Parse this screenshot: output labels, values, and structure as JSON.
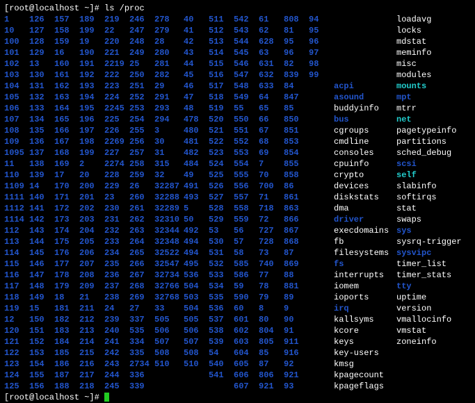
{
  "prompt1": "[root@localhost ~]# ",
  "command": "ls  /proc",
  "prompt2": "[root@localhost ~]# ",
  "columns": [
    [
      "1",
      "10",
      "100",
      "101",
      "102",
      "103",
      "104",
      "105",
      "106",
      "107",
      "108",
      "109",
      "1095",
      "11",
      "110",
      "1109",
      "1111",
      "1112",
      "1114",
      "112",
      "113",
      "114",
      "115",
      "116",
      "117",
      "118",
      "119",
      "12",
      "120",
      "121",
      "122",
      "123",
      "124",
      "125"
    ],
    [
      "126",
      "127",
      "128",
      "129",
      "13",
      "130",
      "131",
      "132",
      "133",
      "134",
      "135",
      "136",
      "137",
      "138",
      "139",
      "14",
      "140",
      "141",
      "142",
      "143",
      "144",
      "145",
      "146",
      "147",
      "148",
      "149",
      "15",
      "150",
      "151",
      "152",
      "153",
      "154",
      "155",
      "156"
    ],
    [
      "157",
      "158",
      "159",
      "16",
      "160",
      "161",
      "162",
      "163",
      "164",
      "165",
      "166",
      "167",
      "168",
      "169",
      "17",
      "170",
      "171",
      "172",
      "173",
      "174",
      "175",
      "176",
      "177",
      "178",
      "179",
      "18",
      "181",
      "182",
      "183",
      "184",
      "185",
      "186",
      "187",
      "188"
    ],
    [
      "189",
      "199",
      "19",
      "190",
      "191",
      "192",
      "193",
      "194",
      "195",
      "196",
      "197",
      "198",
      "199",
      "2",
      "20",
      "200",
      "201",
      "202",
      "203",
      "204",
      "205",
      "206",
      "207",
      "208",
      "209",
      "21",
      "211",
      "212",
      "213",
      "214",
      "215",
      "216",
      "217",
      "218"
    ],
    [
      "219",
      "22",
      "220",
      "221",
      "2219",
      "222",
      "223",
      "224",
      "2245",
      "225",
      "226",
      "2269",
      "227",
      "2274",
      "228",
      "229",
      "23",
      "230",
      "231",
      "232",
      "233",
      "234",
      "235",
      "236",
      "237",
      "238",
      "24",
      "239",
      "240",
      "241",
      "242",
      "243",
      "244",
      "245"
    ],
    [
      "246",
      "247",
      "248",
      "249",
      "25",
      "250",
      "251",
      "252",
      "253",
      "254",
      "255",
      "256",
      "257",
      "258",
      "259",
      "26",
      "260",
      "261",
      "262",
      "263",
      "264",
      "265",
      "266",
      "267",
      "268",
      "269",
      "27",
      "337",
      "535",
      "334",
      "335",
      "2734",
      "336",
      "339"
    ],
    [
      "278",
      "279",
      "28",
      "280",
      "281",
      "282",
      "29",
      "291",
      "293",
      "294",
      "3",
      "30",
      "31",
      "315",
      "32",
      "32287",
      "32288",
      "32289",
      "32310",
      "32344",
      "32348",
      "32522",
      "32547",
      "32734",
      "32766",
      "32768",
      "33",
      "505",
      "506",
      "507",
      "508",
      "510"
    ],
    [
      "40",
      "41",
      "42",
      "43",
      "44",
      "45",
      "46",
      "47",
      "48",
      "478",
      "480",
      "481",
      "482",
      "484",
      "49",
      "491",
      "493",
      "5",
      "50",
      "492",
      "494",
      "494",
      "495",
      "536",
      "504",
      "503",
      "504",
      "505",
      "506",
      "507",
      "508",
      "510"
    ],
    [
      "511",
      "512",
      "513",
      "514",
      "515",
      "516",
      "517",
      "518",
      "519",
      "520",
      "521",
      "522",
      "523",
      "524",
      "525",
      "526",
      "527",
      "528",
      "529",
      "53",
      "530",
      "531",
      "532",
      "533",
      "534",
      "535",
      "536",
      "537",
      "538",
      "539",
      "54",
      "540",
      "541"
    ],
    [
      "542",
      "543",
      "544",
      "545",
      "546",
      "547",
      "548",
      "549",
      "55",
      "550",
      "551",
      "552",
      "553",
      "554",
      "555",
      "556",
      "557",
      "558",
      "559",
      "56",
      "57",
      "58",
      "585",
      "586",
      "59",
      "590",
      "60",
      "601",
      "602",
      "603",
      "604",
      "605",
      "606",
      "607"
    ],
    [
      "61",
      "62",
      "628",
      "63",
      "631",
      "632",
      "633",
      "64",
      "65",
      "66",
      "67",
      "68",
      "69",
      "7",
      "70",
      "700",
      "71",
      "718",
      "72",
      "727",
      "728",
      "73",
      "740",
      "77",
      "78",
      "79",
      "8",
      "80",
      "804",
      "805",
      "85",
      "87",
      "806",
      "921"
    ],
    [
      "808",
      "81",
      "95",
      "96",
      "82",
      "839",
      "84",
      "847",
      "85",
      "850",
      "851",
      "853",
      "854",
      "855",
      "858",
      "86",
      "861",
      "863",
      "866",
      "867",
      "868",
      "87",
      "869",
      "88",
      "881",
      "89",
      "9",
      "90",
      "91",
      "911",
      "916",
      "92",
      "921",
      "93"
    ],
    [
      "94",
      "95",
      "96",
      "97",
      "98",
      "99"
    ]
  ],
  "col13_tail": [
    {
      "t": "acpi",
      "c": "dir"
    },
    {
      "t": "asound",
      "c": "dir"
    },
    {
      "t": "buddyinfo",
      "c": "reg"
    },
    {
      "t": "bus",
      "c": "dir"
    },
    {
      "t": "cgroups",
      "c": "reg"
    },
    {
      "t": "cmdline",
      "c": "reg"
    },
    {
      "t": "consoles",
      "c": "reg"
    },
    {
      "t": "cpuinfo",
      "c": "reg"
    },
    {
      "t": "crypto",
      "c": "reg"
    },
    {
      "t": "devices",
      "c": "reg"
    },
    {
      "t": "diskstats",
      "c": "reg"
    },
    {
      "t": "dma",
      "c": "reg"
    },
    {
      "t": "driver",
      "c": "dir"
    },
    {
      "t": "execdomains",
      "c": "reg"
    },
    {
      "t": "fb",
      "c": "reg"
    },
    {
      "t": "filesystems",
      "c": "reg"
    },
    {
      "t": "fs",
      "c": "dir"
    },
    {
      "t": "interrupts",
      "c": "reg"
    },
    {
      "t": "iomem",
      "c": "reg"
    },
    {
      "t": "ioports",
      "c": "reg"
    },
    {
      "t": "irq",
      "c": "dir"
    },
    {
      "t": "kallsyms",
      "c": "reg"
    },
    {
      "t": "kcore",
      "c": "reg"
    },
    {
      "t": "keys",
      "c": "reg"
    },
    {
      "t": "key-users",
      "c": "reg"
    },
    {
      "t": "kmsg",
      "c": "reg"
    },
    {
      "t": "kpagecount",
      "c": "reg"
    },
    {
      "t": "kpageflags",
      "c": "reg"
    }
  ],
  "col14": [
    {
      "t": "loadavg",
      "c": "reg"
    },
    {
      "t": "locks",
      "c": "reg"
    },
    {
      "t": "mdstat",
      "c": "reg"
    },
    {
      "t": "meminfo",
      "c": "reg"
    },
    {
      "t": "misc",
      "c": "reg"
    },
    {
      "t": "modules",
      "c": "reg"
    },
    {
      "t": "mounts",
      "c": "cyan"
    },
    {
      "t": "mpt",
      "c": "dir"
    },
    {
      "t": "mtrr",
      "c": "reg"
    },
    {
      "t": "net",
      "c": "cyan"
    },
    {
      "t": "pagetypeinfo",
      "c": "reg"
    },
    {
      "t": "partitions",
      "c": "reg"
    },
    {
      "t": "sched_debug",
      "c": "reg"
    },
    {
      "t": "scsi",
      "c": "dir"
    },
    {
      "t": "self",
      "c": "cyan"
    },
    {
      "t": "slabinfo",
      "c": "reg"
    },
    {
      "t": "softirqs",
      "c": "reg"
    },
    {
      "t": "stat",
      "c": "reg"
    },
    {
      "t": "swaps",
      "c": "reg"
    },
    {
      "t": "sys",
      "c": "dir"
    },
    {
      "t": "sysrq-trigger",
      "c": "reg"
    },
    {
      "t": "sysvipc",
      "c": "dir"
    },
    {
      "t": "timer_list",
      "c": "reg"
    },
    {
      "t": "timer_stats",
      "c": "reg"
    },
    {
      "t": "tty",
      "c": "dir"
    },
    {
      "t": "uptime",
      "c": "reg"
    },
    {
      "t": "version",
      "c": "reg"
    },
    {
      "t": "vmallocinfo",
      "c": "reg"
    },
    {
      "t": "vmstat",
      "c": "reg"
    },
    {
      "t": "zoneinfo",
      "c": "reg"
    },
    {
      "t": "",
      "c": "reg"
    },
    {
      "t": "",
      "c": "reg"
    },
    {
      "t": "",
      "c": "reg"
    },
    {
      "t": "",
      "c": "reg"
    }
  ]
}
